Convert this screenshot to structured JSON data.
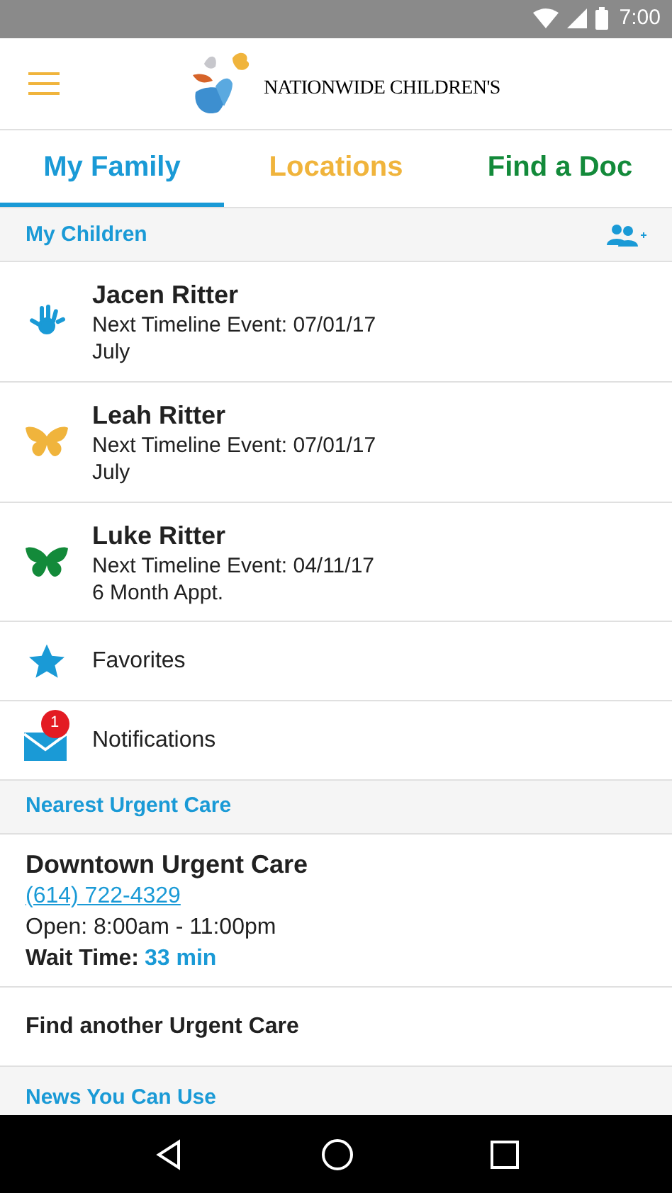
{
  "status_bar": {
    "time": "7:00"
  },
  "app_bar": {
    "logo_text": "NATIONWIDE CHILDREN'S"
  },
  "tabs": [
    {
      "label": "My Family",
      "selected": true,
      "color": "#1a9ad6"
    },
    {
      "label": "Locations",
      "selected": false,
      "color": "#f0b43c"
    },
    {
      "label": "Find a Doc",
      "selected": false,
      "color": "#138a3a"
    }
  ],
  "children_section": {
    "title": "My Children"
  },
  "children": [
    {
      "name": "Jacen Ritter",
      "event": "Next Timeline Event: 07/01/17",
      "detail": "July",
      "kind": "hand",
      "color": "#1a9ad6"
    },
    {
      "name": "Leah Ritter",
      "event": "Next Timeline Event: 07/01/17",
      "detail": "July",
      "kind": "butterfly",
      "color": "#f0b43c"
    },
    {
      "name": "Luke Ritter",
      "event": "Next Timeline Event: 04/11/17",
      "detail": "6 Month Appt.",
      "kind": "butterfly",
      "color": "#138a3a"
    }
  ],
  "menu": [
    {
      "label": "Favorites",
      "kind": "star"
    },
    {
      "label": "Notifications",
      "kind": "mail",
      "badge": "1"
    }
  ],
  "urgent_section": {
    "title": "Nearest Urgent Care"
  },
  "urgent_care": {
    "name": "Downtown Urgent Care",
    "phone": "(614) 722-4329",
    "hours": "Open: 8:00am - 11:00pm",
    "wait_label": "Wait Time:",
    "wait_value": "33 min"
  },
  "find_another": "Find another Urgent Care",
  "news_section": {
    "title": "News You Can Use"
  }
}
